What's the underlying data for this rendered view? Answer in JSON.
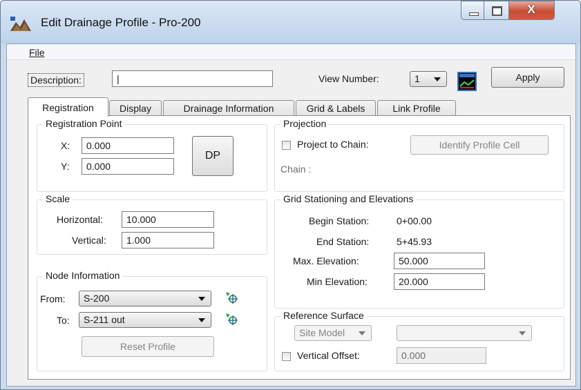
{
  "window": {
    "title": "Edit Drainage Profile - Pro-200",
    "close_glyph": "X"
  },
  "menu": {
    "file": "File"
  },
  "header": {
    "description_label": "Description:",
    "description_value": "|",
    "view_number_label": "View Number:",
    "view_number_value": "1",
    "view_icon": "profile-view-icon",
    "apply_label": "Apply"
  },
  "tabs": [
    {
      "label": "Registration",
      "active": true
    },
    {
      "label": "Display"
    },
    {
      "label": "Drainage Information"
    },
    {
      "label": "Grid & Labels"
    },
    {
      "label": "Link Profile"
    }
  ],
  "registration_point": {
    "title": "Registration Point",
    "x_label": "X:",
    "x_value": "0.000",
    "y_label": "Y:",
    "y_value": "0.000",
    "dp_label": "DP"
  },
  "scale": {
    "title": "Scale",
    "horizontal_label": "Horizontal:",
    "horizontal_value": "10.000",
    "vertical_label": "Vertical:",
    "vertical_value": "1.000"
  },
  "node_information": {
    "title": "Node Information",
    "from_label": "From:",
    "from_value": "S-200",
    "to_label": "To:",
    "to_value": "S-211 out",
    "reset_label": "Reset Profile",
    "node_icon": "node-locate-icon"
  },
  "projection": {
    "title": "Projection",
    "project_to_chain_label": "Project to Chain:",
    "identify_label": "Identify Profile Cell",
    "chain_label": "Chain :"
  },
  "grid": {
    "title": "Grid Stationing and Elevations",
    "begin_station_label": "Begin Station:",
    "begin_station_value": "0+00.00",
    "end_station_label": "End Station:",
    "end_station_value": "5+45.93",
    "max_elev_label": "Max. Elevation:",
    "max_elev_value": "50.000",
    "min_elev_label": "Min Elevation:",
    "min_elev_value": "20.000"
  },
  "reference_surface": {
    "title": "Reference Surface",
    "model_value": "Site Model",
    "surface_value": "",
    "vertical_offset_label": "Vertical Offset:",
    "vertical_offset_value": "0.000"
  },
  "colors": {
    "title_bar": "#c9daee",
    "close_button": "#c94b34"
  }
}
